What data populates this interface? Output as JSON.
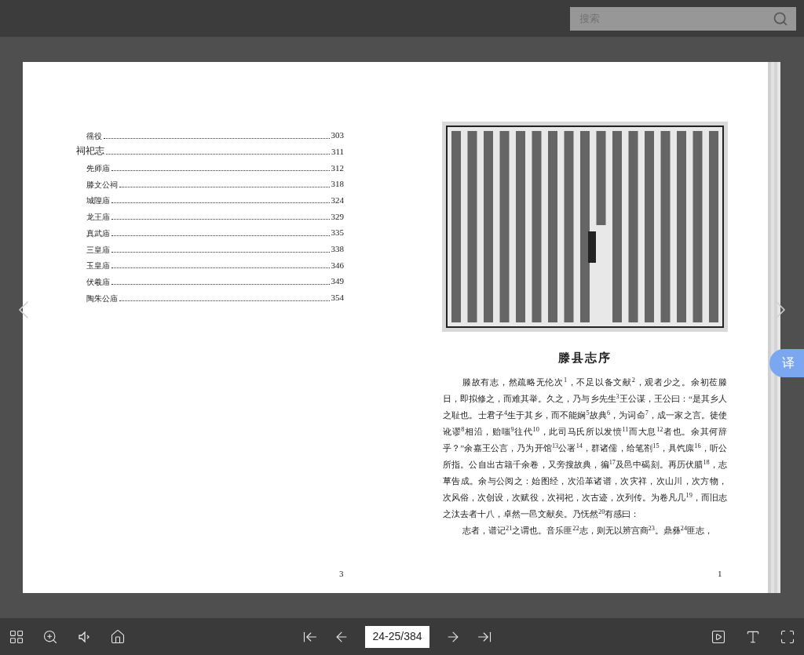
{
  "search": {
    "placeholder": "搜索"
  },
  "left_page": {
    "toc": [
      {
        "kind": "sub",
        "title": "徭役",
        "page": "303"
      },
      {
        "kind": "chapter",
        "title": "祠祀志",
        "page": "311",
        "children": [
          {
            "kind": "sub",
            "title": "先师庙",
            "page": "312"
          },
          {
            "kind": "sub",
            "title": "滕文公祠",
            "page": "318"
          },
          {
            "kind": "sub",
            "title": "城隍庙",
            "page": "324"
          },
          {
            "kind": "sub",
            "title": "龙王庙",
            "page": "329"
          },
          {
            "kind": "sub",
            "title": "真武庙",
            "page": "335"
          },
          {
            "kind": "sub",
            "title": "三皇庙",
            "page": "338"
          },
          {
            "kind": "sub",
            "title": "玉皇庙",
            "page": "346"
          },
          {
            "kind": "sub",
            "title": "伏羲庙",
            "page": "349"
          },
          {
            "kind": "sub",
            "title": "陶朱公庙",
            "page": "354"
          }
        ]
      }
    ],
    "page_number": "3"
  },
  "right_page": {
    "title": "滕县志序",
    "paragraphs": [
      "滕故有志，然疏略无伦次$^{1}$，不足以备文献$^{2}$，观者少之。余初莅滕日，即拟修之，而难其举。久之，乃与乡先生$^{3}$王公谋，王公曰：“是其乡人之耻也。士君子$^{4}$生于其乡，而不能娴$^{5}$故典$^{6}$，为词命$^{7}$，成一家之言。徒使讹谬$^{8}$相沿，贻嗤$^{9}$往代$^{10}$，此司马氏所以发愤$^{11}$而大息$^{12}$者也。余其何辞乎？”余嘉王公言，乃为开馆$^{13}$公署$^{14}$，群诸儒，给笔劄$^{15}$，具饩廪$^{16}$，听公所指。公自出古籍千余卷，又旁搜故典，徧$^{17}$及邑中碣刻。再历伏腊$^{18}$，志草告成。余与公阅之：始图经，次沿革诸谱，次灾祥，次山川，次方物，次风俗，次创设，次赋役，次祠祀，次古迹，次列传。为卷凡几$^{19}$，而旧志之汰去者十八，卓然一邑文献矣。乃怃然$^{20}$有感曰：",
      "志者，谱记$^{21}$之谓也。音乐匪$^{22}$志，则无以辨宫商$^{23}$。鼎彝$^{24}$匪志，"
    ],
    "page_number": "1"
  },
  "translate_button": {
    "label": "译"
  },
  "toolbar": {
    "page_indicator": "24-25/384"
  }
}
